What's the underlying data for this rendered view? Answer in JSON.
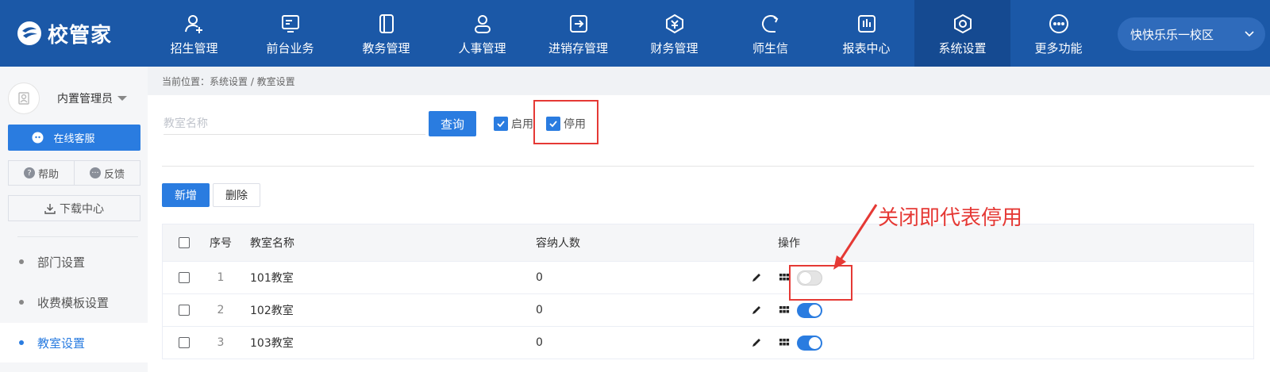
{
  "brand": {
    "name": "校管家",
    "color": "#1b58a7"
  },
  "nav": [
    {
      "label": "招生管理",
      "icon": "user-plus-icon"
    },
    {
      "label": "前台业务",
      "icon": "screen-icon"
    },
    {
      "label": "教务管理",
      "icon": "book-icon"
    },
    {
      "label": "人事管理",
      "icon": "person-icon"
    },
    {
      "label": "进销存管理",
      "icon": "inbox-arrow-icon"
    },
    {
      "label": "财务管理",
      "icon": "money-bag-icon"
    },
    {
      "label": "师生信",
      "icon": "chat-bubble-icon"
    },
    {
      "label": "报表中心",
      "icon": "bar-chart-icon"
    },
    {
      "label": "系统设置",
      "icon": "settings-hex-icon",
      "active": true
    },
    {
      "label": "更多功能",
      "icon": "more-dots-icon"
    }
  ],
  "campus": {
    "name": "快快乐乐一校区"
  },
  "sidebar": {
    "user_name": "内置管理员",
    "online_service": "在线客服",
    "help": "帮助",
    "feedback": "反馈",
    "download_center": "下载中心",
    "menu": [
      {
        "label": "部门设置"
      },
      {
        "label": "收费模板设置"
      },
      {
        "label": "教室设置",
        "active": true
      }
    ]
  },
  "breadcrumb": "当前位置：系统设置 / 教室设置",
  "filter": {
    "search_placeholder": "教室名称",
    "search_value": "",
    "query_label": "查询",
    "enabled_label": "启用",
    "enabled_checked": true,
    "disabled_label": "停用",
    "disabled_checked": true
  },
  "actions": {
    "add_label": "新增",
    "delete_label": "删除"
  },
  "table": {
    "headers": {
      "no": "序号",
      "name": "教室名称",
      "capacity": "容纳人数",
      "ops": "操作"
    },
    "rows": [
      {
        "no": "1",
        "name": "101教室",
        "capacity": "0",
        "enabled": false
      },
      {
        "no": "2",
        "name": "102教室",
        "capacity": "0",
        "enabled": true
      },
      {
        "no": "3",
        "name": "103教室",
        "capacity": "0",
        "enabled": true
      }
    ]
  },
  "annotation": {
    "text": "关闭即代表停用",
    "color": "#e53935"
  }
}
